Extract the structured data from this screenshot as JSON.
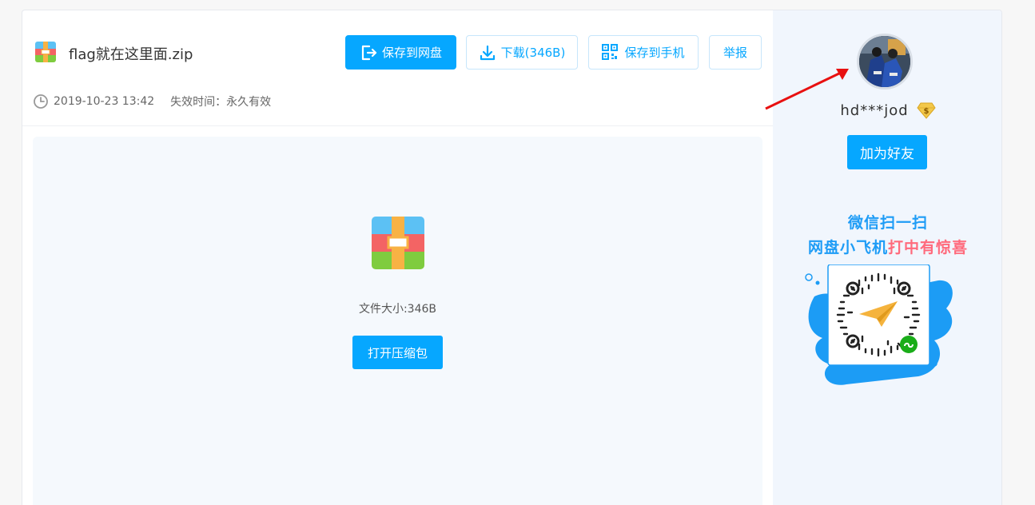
{
  "file": {
    "name": "flag就在这里面.zip",
    "date": "2019-10-23 13:42",
    "expire_label": "失效时间：永久有效",
    "size_text": "文件大小:346B"
  },
  "toolbar": {
    "save_to_disk": "保存到网盘",
    "download": "下载(346B)",
    "save_to_phone": "保存到手机",
    "report": "举报"
  },
  "preview": {
    "open_label": "打开压缩包"
  },
  "sidebar": {
    "username": "hd***jod",
    "add_friend": "加为好友",
    "promo_line1": "微信扫一扫",
    "promo_line2_a": "网盘小飞机",
    "promo_line2_b": "打中有惊喜"
  },
  "colors": {
    "accent": "#06a7ff",
    "promo_blue": "#1e9cf6",
    "promo_pink": "#ff6a7c",
    "arrow": "#e81010"
  },
  "icons": [
    "zip-file-icon",
    "save-to-disk-icon",
    "download-icon",
    "qr-code-icon",
    "clock-icon",
    "vip-diamond-icon",
    "qr-code-image"
  ]
}
